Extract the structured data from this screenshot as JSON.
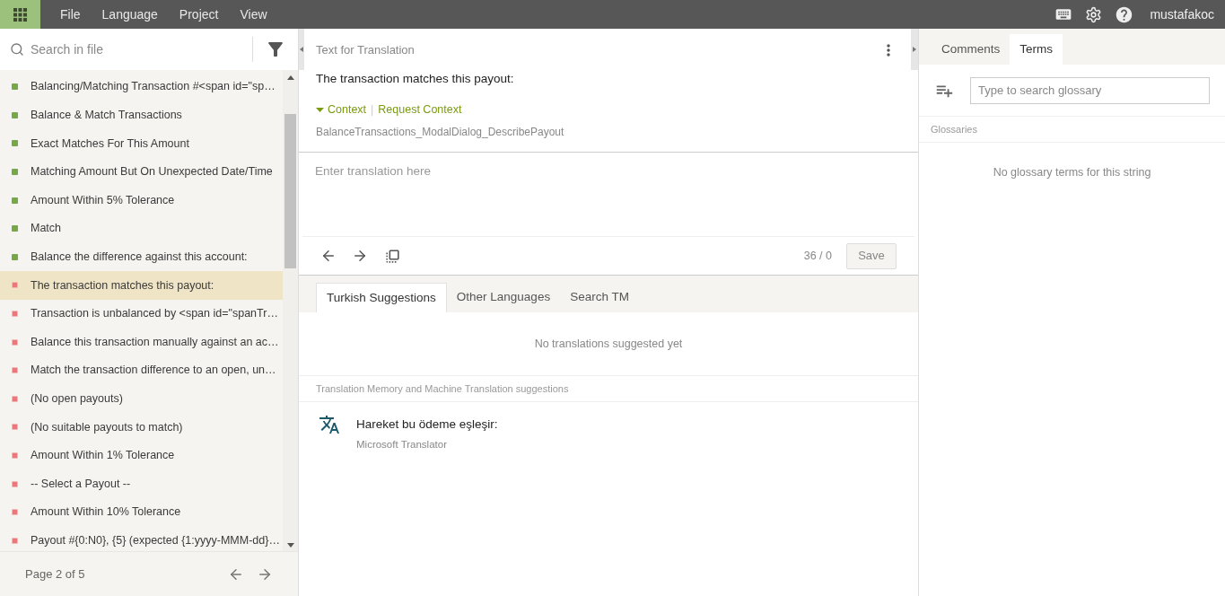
{
  "menu": [
    "File",
    "Language",
    "Project",
    "View"
  ],
  "user": "mustafakoc",
  "search": {
    "placeholder": "Search in file"
  },
  "strings": [
    {
      "text": "Balancing/Matching Transaction #<span id=\"sp…",
      "translated": true,
      "selected": false
    },
    {
      "text": "Balance & Match Transactions",
      "translated": true,
      "selected": false
    },
    {
      "text": "Exact Matches For This Amount",
      "translated": true,
      "selected": false
    },
    {
      "text": "Matching Amount But On Unexpected Date/Time",
      "translated": true,
      "selected": false
    },
    {
      "text": "Amount Within 5% Tolerance",
      "translated": true,
      "selected": false
    },
    {
      "text": "Match",
      "translated": true,
      "selected": false
    },
    {
      "text": "Balance the difference against this account:",
      "translated": true,
      "selected": false
    },
    {
      "text": "The transaction matches this payout:",
      "translated": false,
      "selected": true
    },
    {
      "text": "Transaction is unbalanced by <span id=\"spanTr…",
      "translated": false,
      "selected": false
    },
    {
      "text": "Balance this transaction manually against an ac…",
      "translated": false,
      "selected": false
    },
    {
      "text": "Match the transaction difference to an open, un…",
      "translated": false,
      "selected": false
    },
    {
      "text": "(No open payouts)",
      "translated": false,
      "selected": false
    },
    {
      "text": "(No suitable payouts to match)",
      "translated": false,
      "selected": false
    },
    {
      "text": "Amount Within 1% Tolerance",
      "translated": false,
      "selected": false
    },
    {
      "text": "-- Select a Payout --",
      "translated": false,
      "selected": false
    },
    {
      "text": "Amount Within 10% Tolerance",
      "translated": false,
      "selected": false
    },
    {
      "text": "Payout #{0:N0}, {5} (expected {1:yyyy-MMM-dd}…",
      "translated": false,
      "selected": false
    }
  ],
  "pager": "Page 2 of 5",
  "source": {
    "heading": "Text for Translation",
    "text": "The transaction matches this payout:",
    "context_label": "Context",
    "context_expanded": true,
    "separator": "|",
    "request_context": "Request Context",
    "key": "BalanceTransactions_ModalDialog_DescribePayout"
  },
  "translation": {
    "placeholder": "Enter translation here",
    "counter": "36 / 0",
    "save": "Save"
  },
  "suggestion_tabs": [
    {
      "label": "Turkish Suggestions",
      "selected": true
    },
    {
      "label": "Other Languages",
      "selected": false
    },
    {
      "label": "Search TM",
      "selected": false
    }
  ],
  "no_suggestions": "No translations suggested yet",
  "mt_heading": "Translation Memory and Machine Translation suggestions",
  "mt_suggestions": [
    {
      "text": "Hareket bu ödeme eşleşir:",
      "source": "Microsoft Translator"
    }
  ],
  "side_tabs": [
    {
      "label": "Comments",
      "selected": false
    },
    {
      "label": "Terms",
      "selected": true
    }
  ],
  "glossary": {
    "placeholder": "Type to search glossary",
    "heading": "Glossaries",
    "empty": "No glossary terms for this string"
  }
}
